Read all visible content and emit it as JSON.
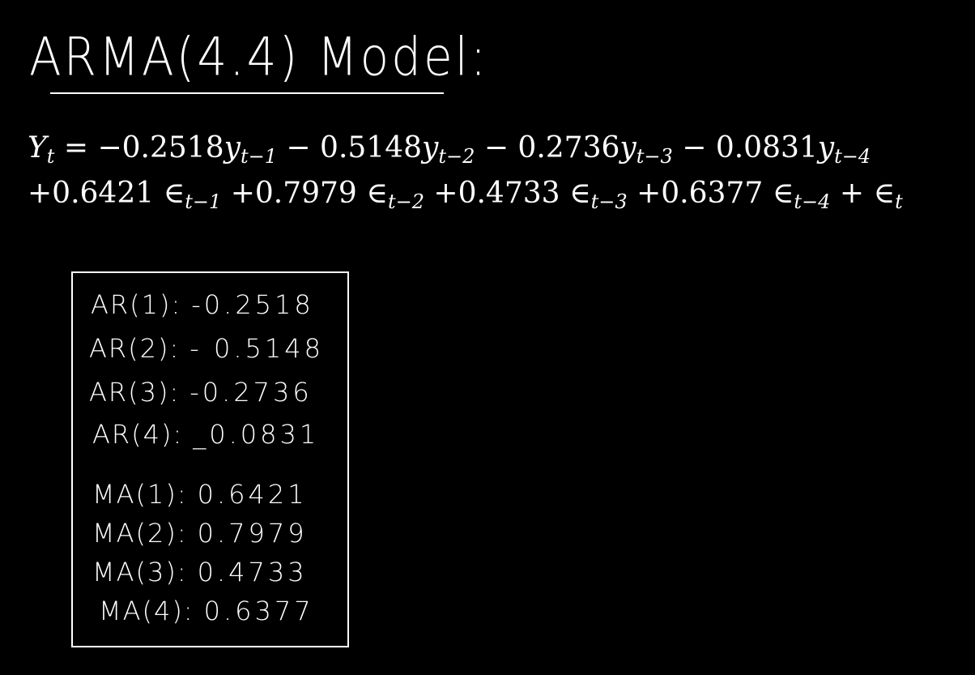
{
  "title": "ARMA(4.4) Model:",
  "equation": {
    "line1": {
      "lhs": "Y",
      "lhs_sub": "t",
      "terms": [
        {
          "prefix": " = −0.2518",
          "var": "y",
          "sub": "t−1"
        },
        {
          "prefix": " − 0.5148",
          "var": "y",
          "sub": "t−2"
        },
        {
          "prefix": " − 0.2736",
          "var": "y",
          "sub": "t−3"
        },
        {
          "prefix": " − 0.0831",
          "var": "y",
          "sub": "t−4"
        }
      ]
    },
    "line2": {
      "terms": [
        {
          "prefix": "+0.6421 ",
          "var": "∈",
          "sub": "t−1"
        },
        {
          "prefix": " +0.7979 ",
          "var": "∈",
          "sub": "t−2"
        },
        {
          "prefix": " +0.4733 ",
          "var": "∈",
          "sub": "t−3"
        },
        {
          "prefix": " +0.6377 ",
          "var": "∈",
          "sub": "t−4"
        },
        {
          "prefix": " + ",
          "var": "∈",
          "sub": "t"
        }
      ]
    }
  },
  "coefficients": {
    "ar": [
      {
        "label": "AR(1):",
        "value": "-0.2518"
      },
      {
        "label": "AR(2):",
        "value": "- 0.5148"
      },
      {
        "label": "AR(3):",
        "value": "-0.2736"
      },
      {
        "label": "AR(4):",
        "value": "_0.0831"
      }
    ],
    "ma": [
      {
        "label": "MA(1):",
        "value": "0.6421"
      },
      {
        "label": "MA(2):",
        "value": "0.7979"
      },
      {
        "label": "MA(3):",
        "value": "0.4733"
      },
      {
        "label": "MA(4):",
        "value": "0.6377"
      }
    ]
  }
}
